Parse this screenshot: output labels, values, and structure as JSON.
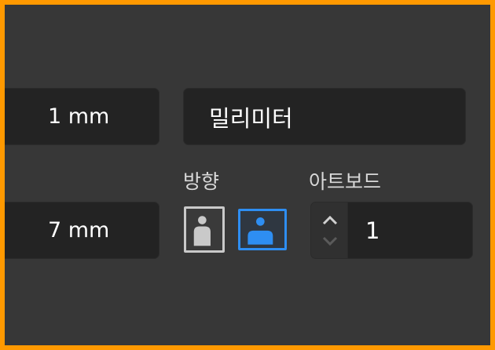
{
  "fields": {
    "width_value": "1 mm",
    "height_value": "7 mm",
    "units_value": "밀리미터",
    "artboards_value": "1"
  },
  "labels": {
    "orientation": "방향",
    "artboards": "아트보드"
  },
  "orientation": {
    "selected": "landscape",
    "portrait_icon": "portrait-person-icon",
    "landscape_icon": "landscape-person-icon"
  },
  "colors": {
    "accent": "#2e8ef2",
    "frame_border": "#ff9900",
    "panel_bg": "#373737",
    "field_bg": "#232323"
  }
}
